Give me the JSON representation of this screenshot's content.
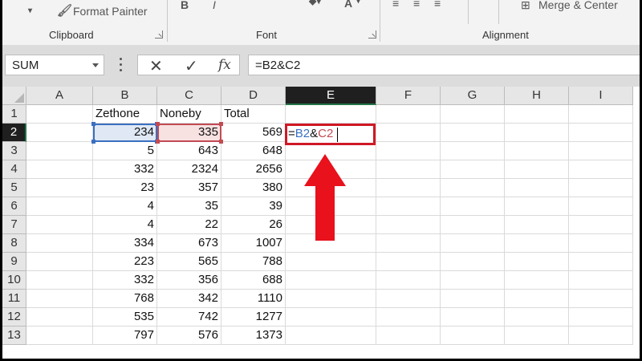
{
  "ribbon": {
    "format_painter": "Format Painter",
    "merge_center": "Merge & Center",
    "bold": "B",
    "italic": "I",
    "font_color": "A",
    "groups": [
      "Clipboard",
      "Font",
      "Alignment"
    ]
  },
  "formula_bar": {
    "name_box": "SUM",
    "cancel_glyph": "✕",
    "enter_glyph": "✓",
    "fx_label": "fx",
    "formula": "=B2&C2"
  },
  "columns": [
    "A",
    "B",
    "C",
    "D",
    "E",
    "F",
    "G",
    "H",
    "I"
  ],
  "active_column": "E",
  "active_row": 2,
  "rows": [
    {
      "n": 1,
      "B": "Zethone",
      "C": "Noneby",
      "D": "Total"
    },
    {
      "n": 2,
      "B": "234",
      "C": "335",
      "D": "569"
    },
    {
      "n": 3,
      "B": "5",
      "C": "643",
      "D": "648"
    },
    {
      "n": 4,
      "B": "332",
      "C": "2324",
      "D": "2656"
    },
    {
      "n": 5,
      "B": "23",
      "C": "357",
      "D": "380"
    },
    {
      "n": 6,
      "B": "4",
      "C": "35",
      "D": "39"
    },
    {
      "n": 7,
      "B": "4",
      "C": "22",
      "D": "26"
    },
    {
      "n": 8,
      "B": "334",
      "C": "673",
      "D": "1007"
    },
    {
      "n": 9,
      "B": "223",
      "C": "565",
      "D": "788"
    },
    {
      "n": 10,
      "B": "332",
      "C": "356",
      "D": "688"
    },
    {
      "n": 11,
      "B": "768",
      "C": "342",
      "D": "1110"
    },
    {
      "n": 12,
      "B": "535",
      "C": "742",
      "D": "1277"
    },
    {
      "n": 13,
      "B": "797",
      "C": "576",
      "D": "1373"
    }
  ],
  "edit_cell": {
    "eq": "=",
    "ref1": "B2",
    "amp": "&",
    "ref2": "C2"
  },
  "colors": {
    "ref_blue": "#3a6fc1",
    "ref_red": "#c24a53",
    "highlight_red": "#d01826",
    "excel_green": "#217346"
  }
}
